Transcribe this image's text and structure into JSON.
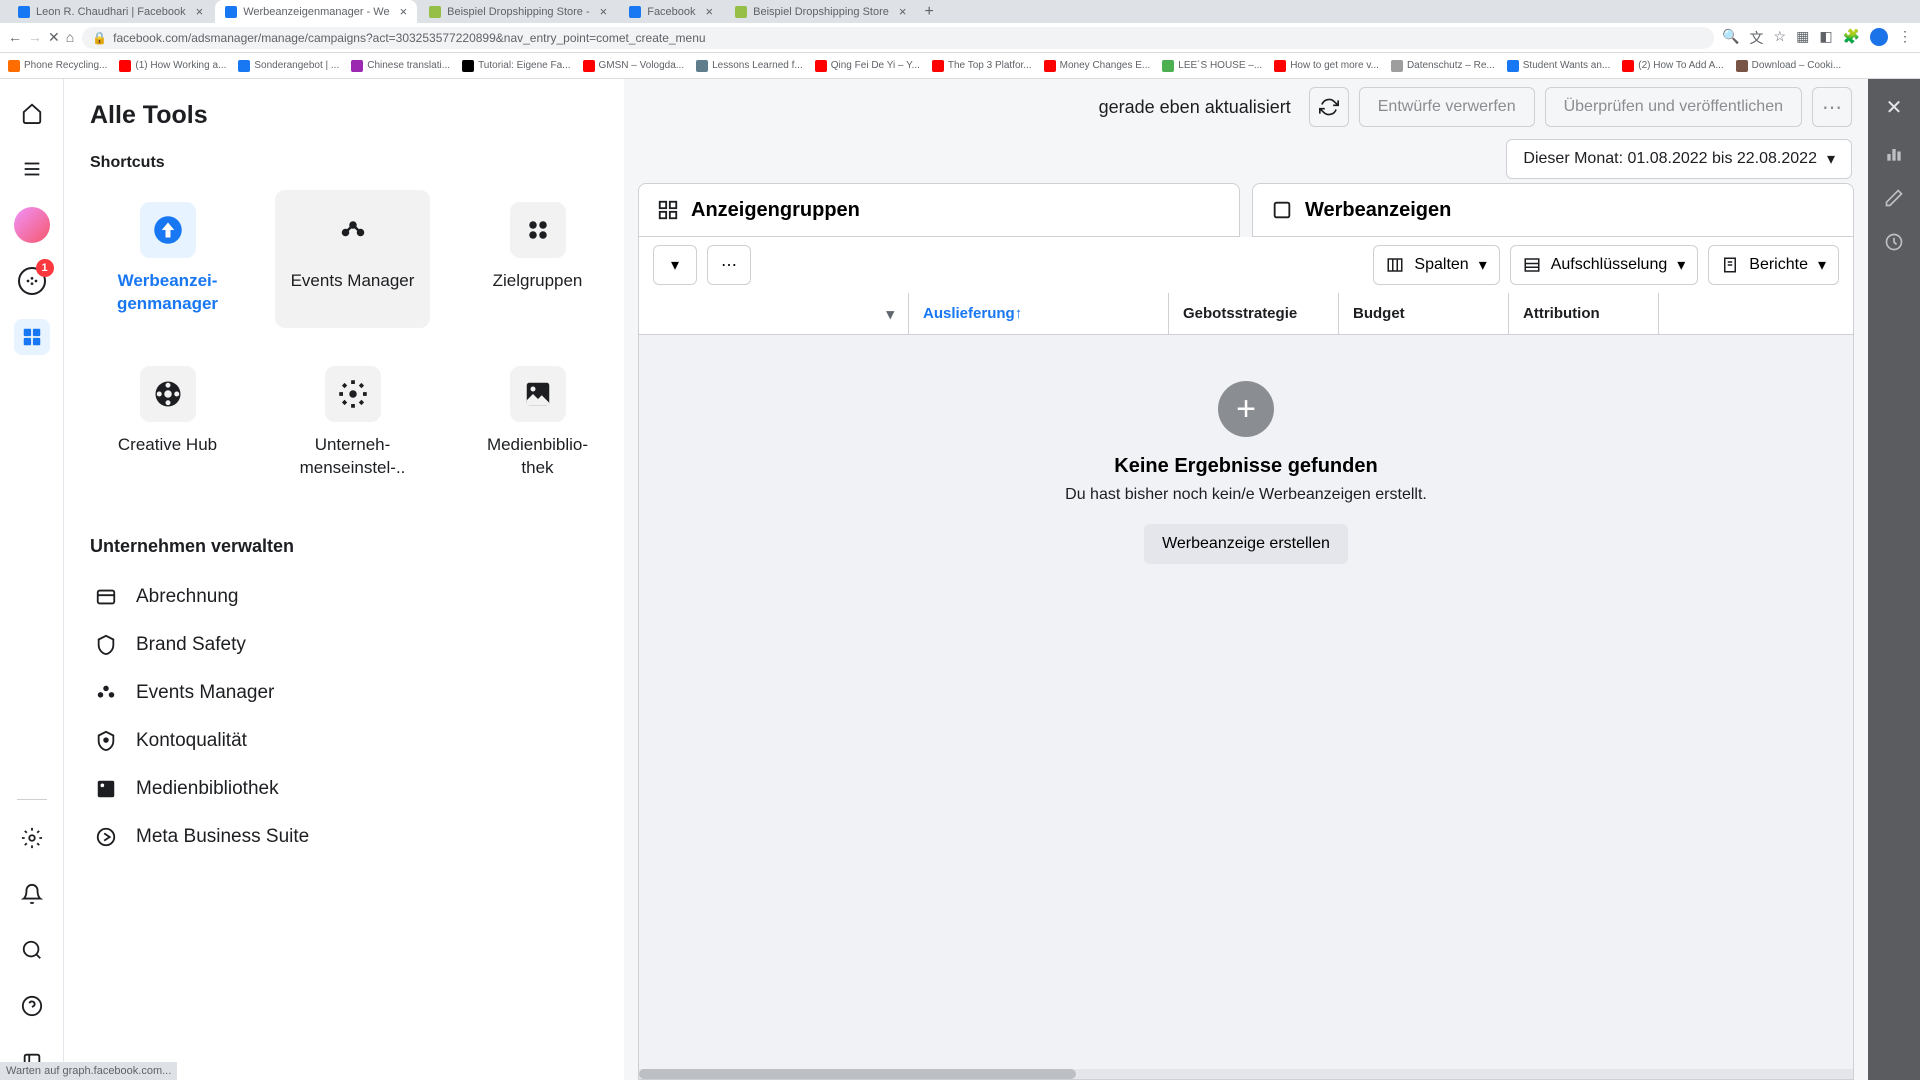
{
  "browser": {
    "tabs": [
      {
        "label": "Leon R. Chaudhari | Facebook",
        "favicon": "#1877f2"
      },
      {
        "label": "Werbeanzeigenmanager - We",
        "favicon": "#1877f2",
        "active": true
      },
      {
        "label": "Beispiel Dropshipping Store -",
        "favicon": "#95bf47"
      },
      {
        "label": "Facebook",
        "favicon": "#1877f2"
      },
      {
        "label": "Beispiel Dropshipping Store",
        "favicon": "#95bf47"
      }
    ],
    "url": "facebook.com/adsmanager/manage/campaigns?act=303253577220899&nav_entry_point=comet_create_menu",
    "status": "Warten auf graph.facebook.com..."
  },
  "bookmarks": [
    {
      "label": "Phone Recycling..."
    },
    {
      "label": "(1) How Working a..."
    },
    {
      "label": "Sonderangebot | ..."
    },
    {
      "label": "Chinese translati..."
    },
    {
      "label": "Tutorial: Eigene Fa..."
    },
    {
      "label": "GMSN – Vologda..."
    },
    {
      "label": "Lessons Learned f..."
    },
    {
      "label": "Qing Fei De Yi – Y..."
    },
    {
      "label": "The Top 3 Platfor..."
    },
    {
      "label": "Money Changes E..."
    },
    {
      "label": "LEE´S HOUSE –..."
    },
    {
      "label": "How to get more v..."
    },
    {
      "label": "Datenschutz – Re..."
    },
    {
      "label": "Student Wants an..."
    },
    {
      "label": "(2) How To Add A..."
    },
    {
      "label": "Download – Cooki..."
    }
  ],
  "rail": {
    "badge": "1"
  },
  "tools": {
    "title": "Alle Tools",
    "shortcuts_label": "Shortcuts",
    "shortcuts": [
      {
        "label": "Werbeanzei-\ngenmanager",
        "active": true
      },
      {
        "label": "Events Manager",
        "hover": true
      },
      {
        "label": "Zielgruppen"
      },
      {
        "label": "Creative Hub"
      },
      {
        "label": "Unterneh-\nmenseinstel-.."
      },
      {
        "label": "Medienbiblio-\nthek"
      }
    ],
    "section": "Unternehmen verwalten",
    "items": [
      "Abrechnung",
      "Brand Safety",
      "Events Manager",
      "Kontoqualität",
      "Medienbibliothek",
      "Meta Business Suite"
    ]
  },
  "top": {
    "updated": "gerade eben aktualisiert",
    "discard": "Entwürfe verwerfen",
    "review": "Überprüfen und veröffentlichen",
    "date": "Dieser Monat: 01.08.2022 bis 22.08.2022"
  },
  "viewtabs": {
    "groups": "Anzeigengruppen",
    "ads": "Werbeanzeigen"
  },
  "toolbar": {
    "columns": "Spalten",
    "breakdown": "Aufschlüsselung",
    "reports": "Berichte"
  },
  "table": {
    "cols": [
      "",
      "Auslieferung",
      "Gebotsstrategie",
      "Budget",
      "Attribution"
    ],
    "sorted_idx": 1,
    "empty_title": "Keine Ergebnisse gefunden",
    "empty_sub": "Du hast bisher noch kein/e Werbeanzeigen erstellt.",
    "create": "Werbeanzeige erstellen"
  }
}
